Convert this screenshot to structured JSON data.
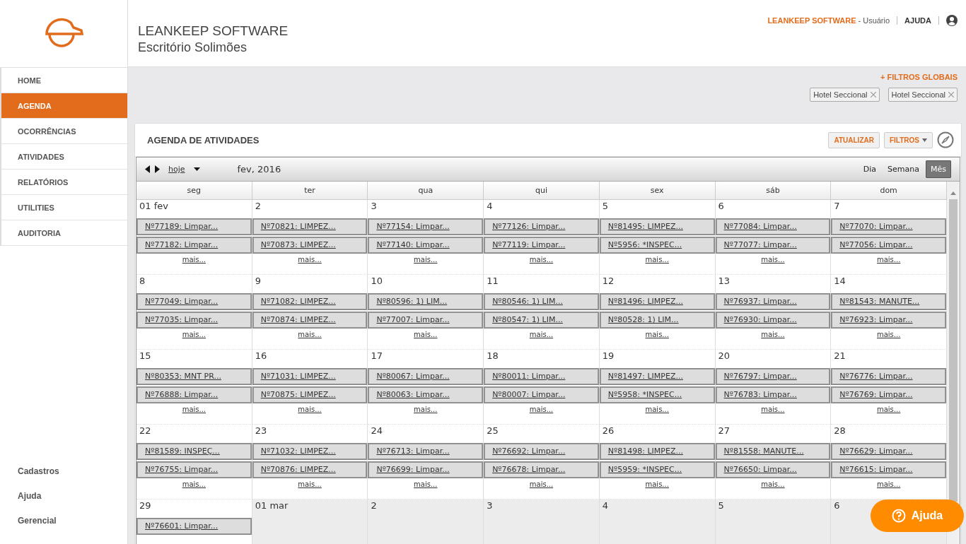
{
  "brand": {
    "company": "LEANKEEP SOFTWARE",
    "office": "Escritório Solimões"
  },
  "top_bar": {
    "company": "LEANKEEP SOFTWARE",
    "user": "- Usuário",
    "help": "AJUDA"
  },
  "sidebar": {
    "items": [
      {
        "label": "HOME",
        "selected": false
      },
      {
        "label": "AGENDA",
        "selected": true
      },
      {
        "label": "OCORRÊNCIAS",
        "selected": false
      },
      {
        "label": "ATIVIDADES",
        "selected": false
      },
      {
        "label": "RELATÓRIOS",
        "selected": false
      },
      {
        "label": "UTILITIES",
        "selected": false
      },
      {
        "label": "AUDITORIA",
        "selected": false
      }
    ],
    "footer_items": [
      "Cadastros",
      "Ajuda",
      "Gerencial"
    ]
  },
  "filters": {
    "toggle": "+ FILTROS GLOBAIS",
    "chips": [
      {
        "label": "Hotel Seccional"
      },
      {
        "label": "Hotel Seccional"
      }
    ]
  },
  "panel": {
    "title": "AGENDA DE ATIVIDADES",
    "buttons": [
      {
        "label": "ATUALIZAR",
        "dropdown": false
      },
      {
        "label": "FILTROS",
        "dropdown": true
      }
    ]
  },
  "calendar": {
    "today": "hoje",
    "period": "fev, 2016",
    "views": [
      {
        "label": "Dia",
        "selected": false
      },
      {
        "label": "Semana",
        "selected": false
      },
      {
        "label": "Mês",
        "selected": true
      }
    ],
    "weekdays": [
      "seg",
      "ter",
      "qua",
      "qui",
      "sex",
      "sáb",
      "dom"
    ],
    "weeks": [
      [
        {
          "label": "01 fev",
          "other_month": false,
          "events": [
            "Nº77189: Limpar...",
            "Nº77182: Limpar..."
          ],
          "more": "mais..."
        },
        {
          "label": "2",
          "other_month": false,
          "events": [
            "Nº70821: LIMPEZ...",
            "Nº70873: LIMPEZ..."
          ],
          "more": "mais..."
        },
        {
          "label": "3",
          "other_month": false,
          "events": [
            "Nº77154: Limpar...",
            "Nº77140: Limpar..."
          ],
          "more": "mais..."
        },
        {
          "label": "4",
          "other_month": false,
          "events": [
            "Nº77126: Limpar...",
            "Nº77119: Limpar..."
          ],
          "more": "mais..."
        },
        {
          "label": "5",
          "other_month": false,
          "events": [
            "Nº81495: LIMPEZ...",
            "Nº5956: *INSPEC..."
          ],
          "more": "mais..."
        },
        {
          "label": "6",
          "other_month": false,
          "events": [
            "Nº77084: Limpar...",
            "Nº77077: Limpar..."
          ],
          "more": "mais..."
        },
        {
          "label": "7",
          "other_month": false,
          "events": [
            "Nº77070: Limpar...",
            "Nº77056: Limpar..."
          ],
          "more": "mais..."
        }
      ],
      [
        {
          "label": "8",
          "other_month": false,
          "events": [
            "Nº77049: Limpar...",
            "Nº77035: Limpar..."
          ],
          "more": "mais..."
        },
        {
          "label": "9",
          "other_month": false,
          "events": [
            "Nº71082: LIMPEZ...",
            "Nº70874: LIMPEZ..."
          ],
          "more": "mais..."
        },
        {
          "label": "10",
          "other_month": false,
          "events": [
            "Nº80596: 1) LIM...",
            "Nº77007: Limpar..."
          ],
          "more": "mais..."
        },
        {
          "label": "11",
          "other_month": false,
          "events": [
            "Nº80546: 1) LIM...",
            "Nº80547: 1) LIM..."
          ],
          "more": "mais..."
        },
        {
          "label": "12",
          "other_month": false,
          "events": [
            "Nº81496: LIMPEZ...",
            "Nº80528: 1) LIM..."
          ],
          "more": "mais..."
        },
        {
          "label": "13",
          "other_month": false,
          "events": [
            "Nº76937: Limpar...",
            "Nº76930: Limpar..."
          ],
          "more": "mais..."
        },
        {
          "label": "14",
          "other_month": false,
          "events": [
            "Nº81543: MANUTE...",
            "Nº76923: Limpar..."
          ],
          "more": "mais..."
        }
      ],
      [
        {
          "label": "15",
          "other_month": false,
          "events": [
            "Nº80353: MNT PR...",
            "Nº76888: Limpar..."
          ],
          "more": "mais..."
        },
        {
          "label": "16",
          "other_month": false,
          "events": [
            "Nº71031: LIMPEZ...",
            "Nº70875: LIMPEZ..."
          ],
          "more": "mais..."
        },
        {
          "label": "17",
          "other_month": false,
          "events": [
            "Nº80067: Limpar...",
            "Nº80063: Limpar..."
          ],
          "more": "mais..."
        },
        {
          "label": "18",
          "other_month": false,
          "events": [
            "Nº80011: Limpar...",
            "Nº80007: Limpar..."
          ],
          "more": "mais..."
        },
        {
          "label": "19",
          "other_month": false,
          "events": [
            "Nº81497: LIMPEZ...",
            "Nº5958: *INSPEC..."
          ],
          "more": "mais..."
        },
        {
          "label": "20",
          "other_month": false,
          "events": [
            "Nº76797: Limpar...",
            "Nº76783: Limpar..."
          ],
          "more": "mais..."
        },
        {
          "label": "21",
          "other_month": false,
          "events": [
            "Nº76776: Limpar...",
            "Nº76769: Limpar..."
          ],
          "more": "mais..."
        }
      ],
      [
        {
          "label": "22",
          "other_month": false,
          "events": [
            "Nº81589: INSPEÇ...",
            "Nº76755: Limpar..."
          ],
          "more": "mais..."
        },
        {
          "label": "23",
          "other_month": false,
          "events": [
            "Nº71032: LIMPEZ...",
            "Nº70876: LIMPEZ..."
          ],
          "more": "mais..."
        },
        {
          "label": "24",
          "other_month": false,
          "events": [
            "Nº76713: Limpar...",
            "Nº76699: Limpar..."
          ],
          "more": "mais..."
        },
        {
          "label": "25",
          "other_month": false,
          "events": [
            "Nº76692: Limpar...",
            "Nº76678: Limpar..."
          ],
          "more": "mais..."
        },
        {
          "label": "26",
          "other_month": false,
          "events": [
            "Nº81498: LIMPEZ...",
            "Nº5959: *INSPEC..."
          ],
          "more": "mais..."
        },
        {
          "label": "27",
          "other_month": false,
          "events": [
            "Nº81558: MANUTE...",
            "Nº76650: Limpar..."
          ],
          "more": "mais..."
        },
        {
          "label": "28",
          "other_month": false,
          "events": [
            "Nº76629: Limpar...",
            "Nº76615: Limpar..."
          ],
          "more": "mais..."
        }
      ],
      [
        {
          "label": "29",
          "other_month": false,
          "events": [
            "Nº76601: Limpar..."
          ]
        },
        {
          "label": "01 mar",
          "other_month": true
        },
        {
          "label": "2",
          "other_month": true
        },
        {
          "label": "3",
          "other_month": true
        },
        {
          "label": "4",
          "other_month": true
        },
        {
          "label": "5",
          "other_month": true
        },
        {
          "label": "6",
          "other_month": true
        }
      ]
    ]
  },
  "help_button": {
    "label": "Ajuda"
  }
}
